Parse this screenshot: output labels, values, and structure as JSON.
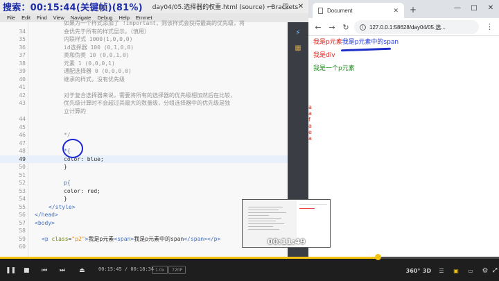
{
  "editor": {
    "search_text": "搜索：00:15:44(关键帧)(81%)",
    "title": "day04/05.选择器的权重.html (source) - Brackets",
    "menu": [
      "File",
      "Edit",
      "Find",
      "View",
      "Navigate",
      "Debug",
      "Help",
      "Emmet"
    ],
    "lines": [
      {
        "n": "",
        "t": "如果为一个样式添加了 !important，则该样式会获得最高的优先级，将"
      },
      {
        "n": "34",
        "t": "会优先于所有的样式显示。（慎用）"
      },
      {
        "n": "35",
        "t": "    内联样式   1000(1,0,0,0)"
      },
      {
        "n": "36",
        "t": "    id选择器   100 (0,1,0,0)"
      },
      {
        "n": "37",
        "t": "    类和伪类   10 (0,0,1,0)"
      },
      {
        "n": "38",
        "t": "    元素       1 (0,0,0,1)"
      },
      {
        "n": "39",
        "t": "    通配选择器 0 (0,0,0,0)"
      },
      {
        "n": "40",
        "t": "    继承的样式，没有优先级"
      },
      {
        "n": "41",
        "t": ""
      },
      {
        "n": "42",
        "t": "对于复合选择器来说，需要将所有的选择器的优先级相加然后在比较，"
      },
      {
        "n": "43",
        "t": "  优先级计算时不会超过其最大的数量级，分组选择器中的优先级是独"
      },
      {
        "n": "",
        "t": "  立计算的"
      },
      {
        "n": "44",
        "t": ""
      },
      {
        "n": "45",
        "t": ""
      },
      {
        "n": "46",
        "t": "*/"
      },
      {
        "n": "47",
        "t": ""
      },
      {
        "n": "48",
        "t": "*{"
      },
      {
        "n": "49",
        "t": "    color: blue;"
      },
      {
        "n": "50",
        "t": "}"
      },
      {
        "n": "51",
        "t": ""
      },
      {
        "n": "52",
        "t": "p{"
      },
      {
        "n": "53",
        "t": "    color: red;"
      },
      {
        "n": "54",
        "t": "}"
      },
      {
        "n": "55",
        "t": "</style>"
      },
      {
        "n": "56",
        "t": "</head>"
      },
      {
        "n": "57",
        "t": "<body>"
      },
      {
        "n": "58",
        "t": ""
      },
      {
        "n": "59",
        "t": "<p class=\"p2\">我是p元素<span>我是p元素中的span</span></p>"
      },
      {
        "n": "60",
        "t": ""
      }
    ],
    "active_line": "49"
  },
  "browser": {
    "tab_title": "Document",
    "url": "127.0.0.1:58628/day04/05.选...",
    "p1_text": "我是p元素",
    "p1_span": "我是p元素中的span",
    "div_text": "我是div",
    "p_text": "我是一个p元素",
    "side_chars": [
      "a",
      "a",
      "f",
      "a",
      "e",
      "a"
    ]
  },
  "thumbnail": {
    "time": "00:11:49"
  },
  "player": {
    "current_time": "00:15:45",
    "total_time": "00:18:34",
    "pill_1": "1.0x",
    "pill_2": "720P",
    "progress": 0.757,
    "icons": [
      "360",
      "3D",
      "list",
      "danmaku",
      "subtitle",
      "settings",
      "fullscreen"
    ]
  },
  "colors": {
    "progress": "#f2c311",
    "search_overlay": "#1e2fa8",
    "annotation": "#1a23d6",
    "red_text": "#e0231b",
    "blue_text": "#2039d6",
    "green_text": "#1a8a1a"
  }
}
